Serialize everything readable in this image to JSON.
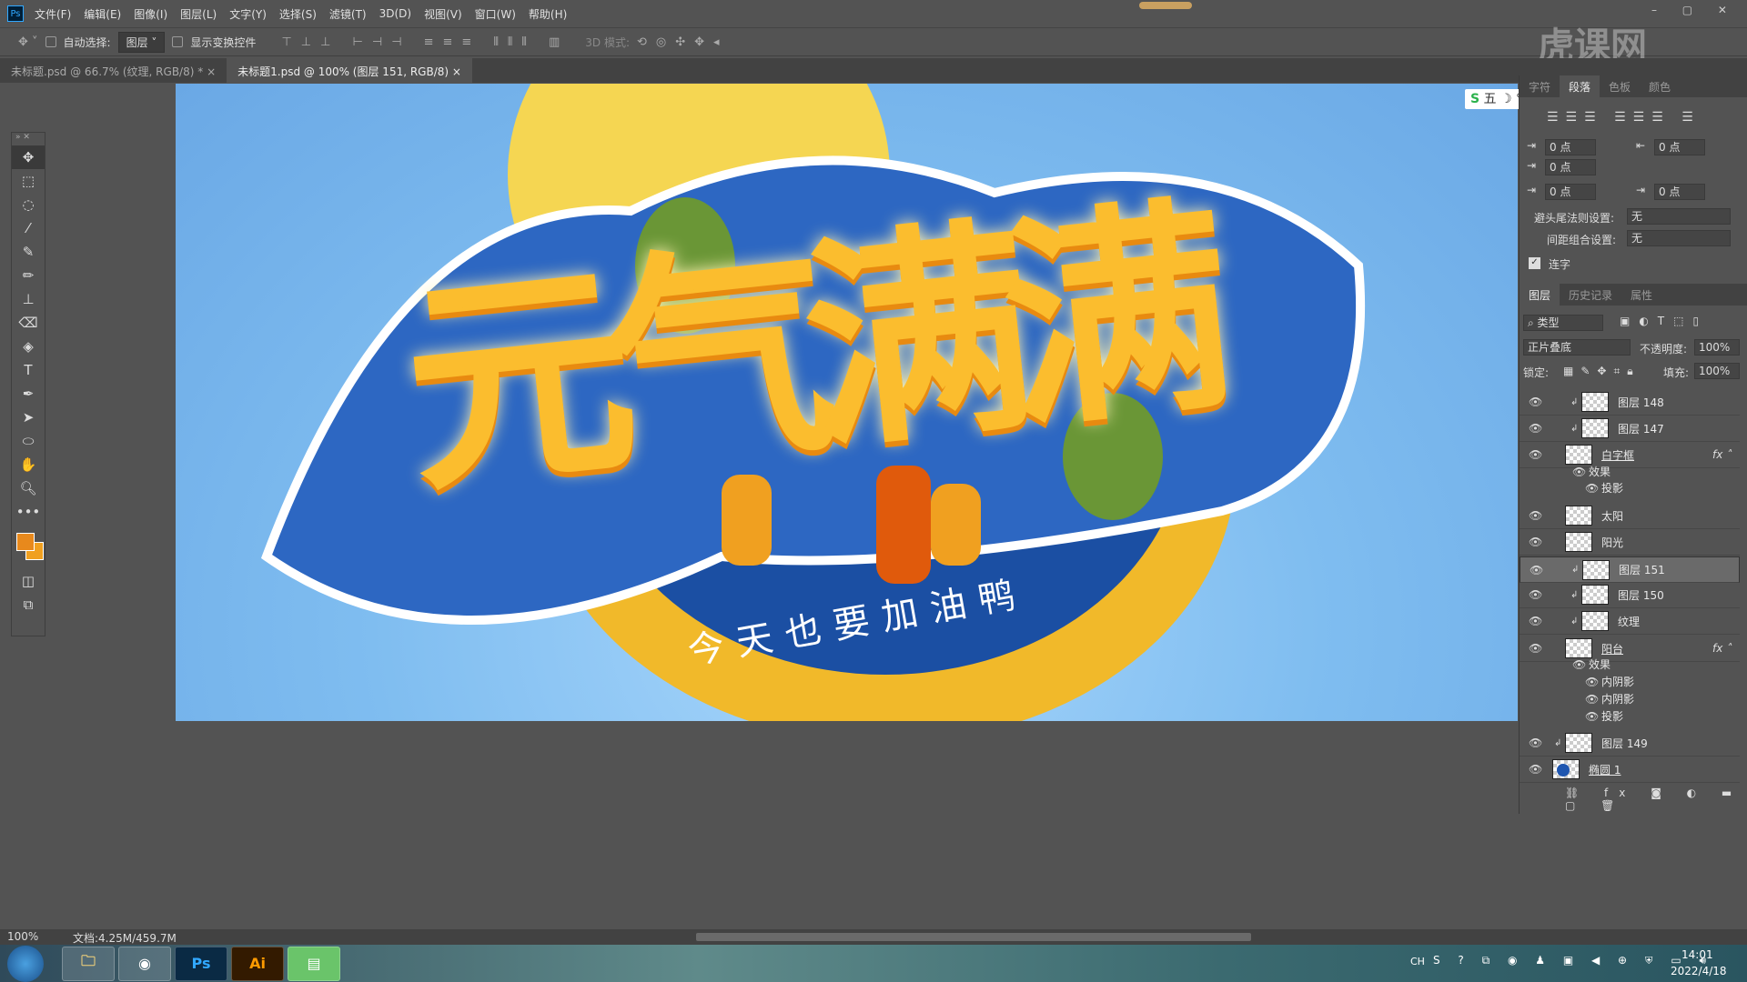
{
  "menu": {
    "logo": "Ps",
    "items": [
      "文件(F)",
      "编辑(E)",
      "图像(I)",
      "图层(L)",
      "文字(Y)",
      "选择(S)",
      "滤镜(T)",
      "3D(D)",
      "视图(V)",
      "窗口(W)",
      "帮助(H)"
    ]
  },
  "options": {
    "auto_select_label": "自动选择:",
    "auto_select_value": "图层",
    "show_transform_label": "显示变换控件",
    "mode_3d_label": "3D 模式:"
  },
  "tabs": [
    {
      "label": "未标题.psd @ 66.7% (纹理, RGB/8) *",
      "active": false
    },
    {
      "label": "未标题1.psd @ 100% (图层 151, RGB/8)",
      "active": true
    }
  ],
  "watermark": "虎课网",
  "ime": {
    "label": "五"
  },
  "artwork": {
    "title": "元气满满",
    "banner": "今天也要加油鸭"
  },
  "colors": {
    "fg": "#e8891c",
    "bg": "#f0a020",
    "canvas_bg": "#7fbdf0",
    "accent": "#1f56b0"
  },
  "paragraph_panel": {
    "tabs": [
      "字符",
      "段落",
      "色板",
      "颜色"
    ],
    "active_tab": "段落",
    "indent_left": "0 点",
    "indent_right": "0 点",
    "indent_first": "0 点",
    "space_before": "0 点",
    "space_after": "0 点",
    "kinsoku_label": "避头尾法则设置:",
    "kinsoku_value": "无",
    "mojikumi_label": "间距组合设置:",
    "mojikumi_value": "无",
    "hyphenate_label": "连字",
    "hyphenate_checked": true
  },
  "layers_panel": {
    "tabs": [
      "图层",
      "历史记录",
      "属性"
    ],
    "active_tab": "图层",
    "filter": "类型",
    "blend_mode": "正片叠底",
    "opacity_label": "不透明度:",
    "opacity": "100%",
    "lock_label": "锁定:",
    "fill_label": "填充:",
    "fill": "100%",
    "layers": [
      {
        "name": "图层 148",
        "kind": "layer",
        "clipped": true
      },
      {
        "name": "图层 147",
        "kind": "layer",
        "clipped": true
      },
      {
        "name": "白字框",
        "kind": "layer",
        "fx": true,
        "underline": true
      },
      {
        "name": "效果",
        "kind": "effects"
      },
      {
        "name": "投影",
        "kind": "effect"
      },
      {
        "name": "太阳",
        "kind": "layer"
      },
      {
        "name": "阳光",
        "kind": "layer"
      },
      {
        "name": "图层 151",
        "kind": "layer",
        "clipped": true,
        "selected": true
      },
      {
        "name": "图层 150",
        "kind": "layer",
        "clipped": true
      },
      {
        "name": "纹理",
        "kind": "layer",
        "clipped": true
      },
      {
        "name": "阳台",
        "kind": "layer",
        "fx": true,
        "underline": true
      },
      {
        "name": "效果",
        "kind": "effects"
      },
      {
        "name": "内阴影",
        "kind": "effect"
      },
      {
        "name": "内阴影",
        "kind": "effect"
      },
      {
        "name": "投影",
        "kind": "effect"
      },
      {
        "name": "图层 149",
        "kind": "layer",
        "clipped": true
      },
      {
        "name": "椭圆 1",
        "kind": "shape",
        "underline": true
      }
    ]
  },
  "status": {
    "zoom": "100%",
    "doc": "文档:4.25M/459.7M"
  },
  "taskbar": {
    "apps": [
      "Explorer",
      "OBS",
      "Ps",
      "Ai",
      "Notes"
    ],
    "lang": "CH",
    "time": "14:01",
    "date": "2022/4/18"
  }
}
